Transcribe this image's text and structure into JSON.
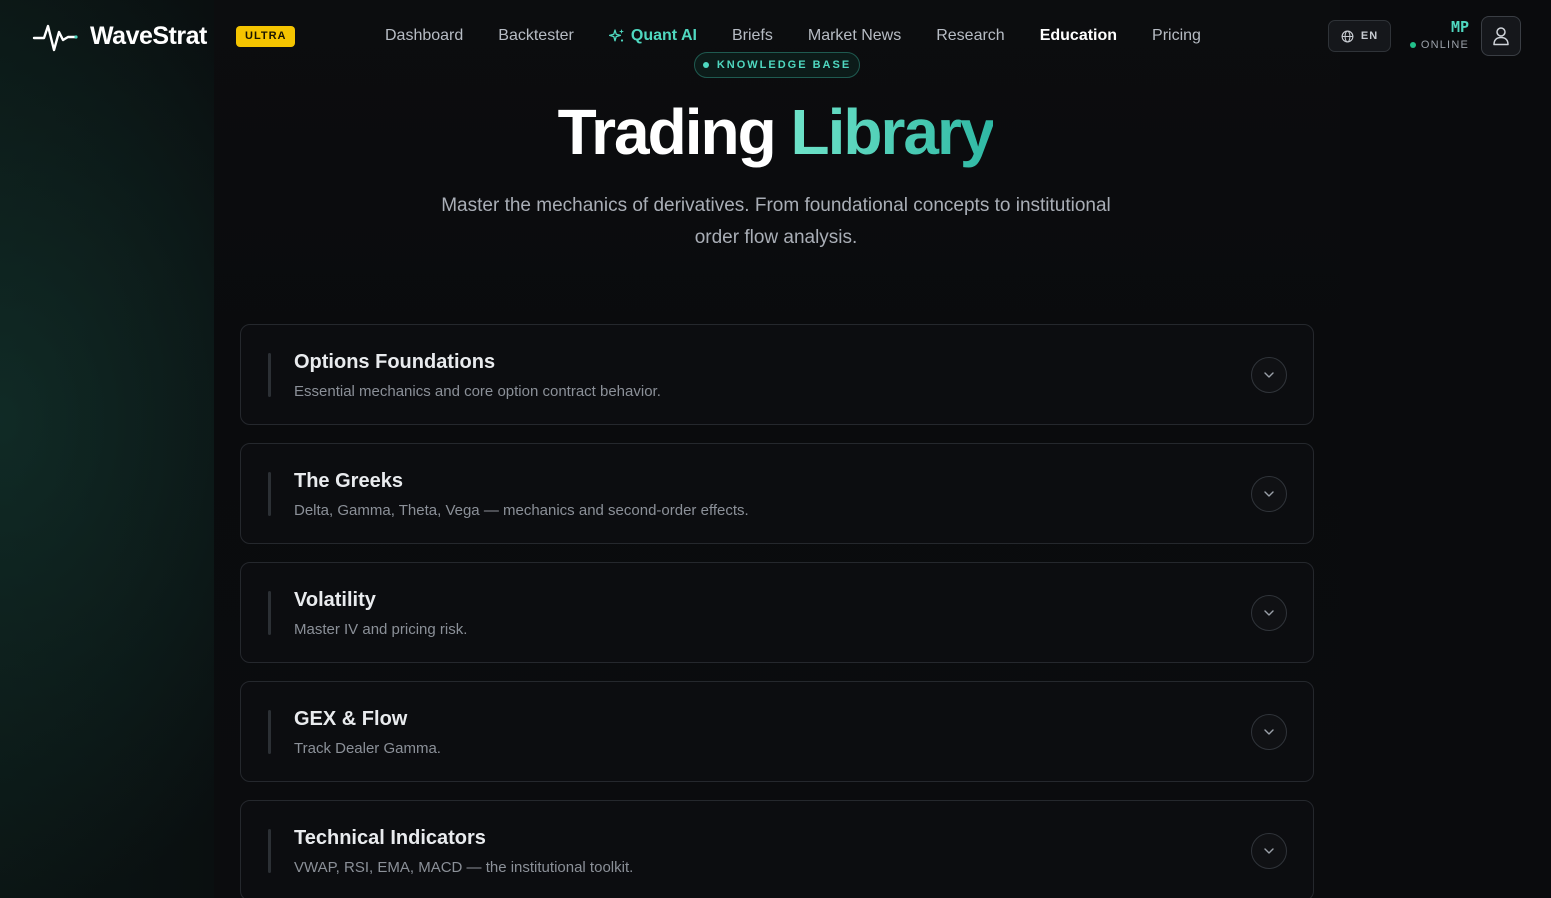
{
  "brand": {
    "name": "WaveStrat",
    "badge": "ULTRA",
    "accent_color": "#4fd8c0",
    "badge_color": "#f5c400"
  },
  "nav": {
    "links": [
      {
        "label": "Dashboard",
        "state": "default"
      },
      {
        "label": "Backtester",
        "state": "default"
      },
      {
        "label": "Quant AI",
        "state": "highlight",
        "icon": "sparkle-icon"
      },
      {
        "label": "Briefs",
        "state": "default"
      },
      {
        "label": "Market News",
        "state": "default"
      },
      {
        "label": "Research",
        "state": "default"
      },
      {
        "label": "Education",
        "state": "active"
      },
      {
        "label": "Pricing",
        "state": "default"
      }
    ],
    "language": "EN",
    "user": {
      "initials": "MP",
      "status": "ONLINE"
    }
  },
  "hero": {
    "eyebrow": "KNOWLEDGE BASE",
    "title_main": "Trading",
    "title_accent": "Library",
    "subtitle_line1": "Master the mechanics of derivatives. From foundational concepts to institutional",
    "subtitle_line2": "order flow analysis."
  },
  "modules": [
    {
      "title": "Options Foundations",
      "description": "Essential mechanics and core option contract behavior."
    },
    {
      "title": "The Greeks",
      "description": "Delta, Gamma, Theta, Vega — mechanics and second-order effects."
    },
    {
      "title": "Volatility",
      "description": "Master IV and pricing risk."
    },
    {
      "title": "GEX & Flow",
      "description": "Track Dealer Gamma."
    },
    {
      "title": "Technical Indicators",
      "description": "VWAP, RSI, EMA, MACD — the institutional toolkit."
    }
  ]
}
